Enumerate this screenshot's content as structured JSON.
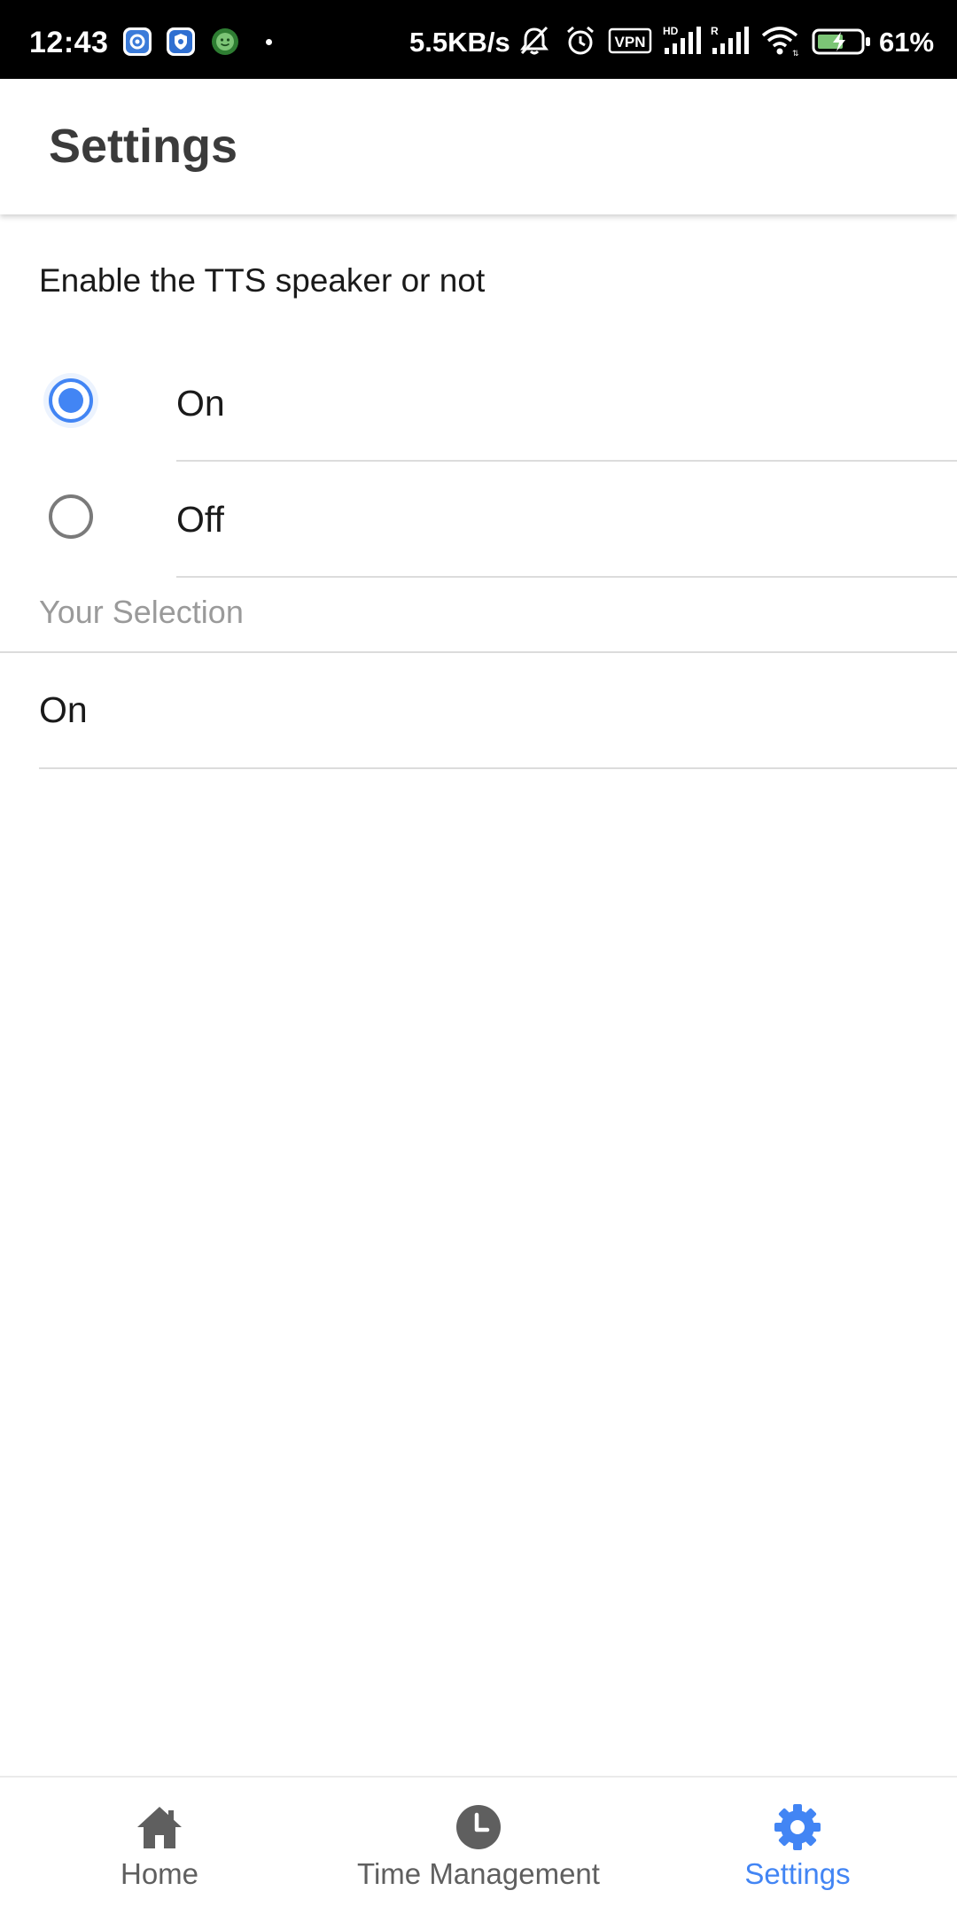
{
  "status_bar": {
    "time": "12:43",
    "speed": "5.5KB/s",
    "vpn": "VPN",
    "battery_percent": "61%",
    "icons": [
      "gear-app-icon",
      "shield-app-icon",
      "face-app-icon",
      "notification-dot",
      "mute-bell-icon",
      "alarm-icon",
      "vpn-icon",
      "signal-hd-icon",
      "signal-r-icon",
      "wifi-icon",
      "battery-charging-icon"
    ]
  },
  "app_bar": {
    "title": "Settings"
  },
  "settings": {
    "prompt": "Enable the TTS speaker or not",
    "options": [
      {
        "label": "On",
        "selected": true
      },
      {
        "label": "Off",
        "selected": false
      }
    ],
    "selection_caption": "Your Selection",
    "selection_value": "On"
  },
  "bottom_nav": {
    "items": [
      {
        "label": "Home",
        "icon": "home-icon",
        "active": false
      },
      {
        "label": "Time Management",
        "icon": "clock-icon",
        "active": false
      },
      {
        "label": "Settings",
        "icon": "gear-icon",
        "active": true
      }
    ]
  },
  "colors": {
    "accent": "#4285f4",
    "inactive_icon": "#5f5f5f",
    "caption": "#9a9a9a",
    "divider": "#dcdcdc"
  }
}
